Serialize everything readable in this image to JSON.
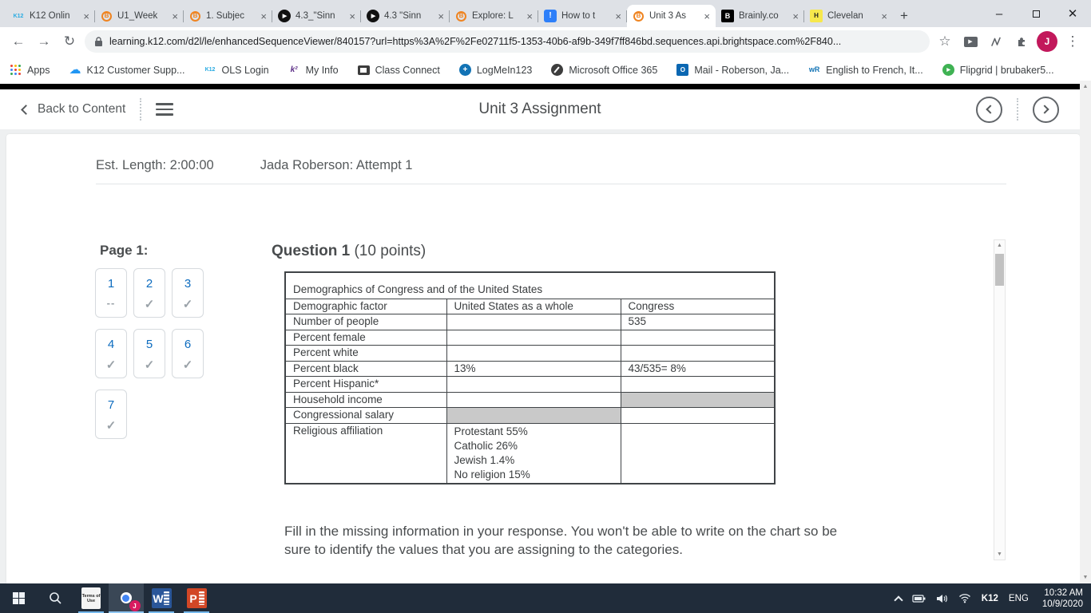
{
  "icons": {
    "close_tab": "×",
    "new_tab": "+",
    "minimize": "–",
    "close_window": "✕",
    "back": "←",
    "forward": "→",
    "reload": "↻",
    "star": "☆",
    "kebab": "⋮",
    "check": "✓",
    "dash": "--",
    "play": "▶",
    "scroll_up": "▲",
    "scroll_down": "▼"
  },
  "browser": {
    "tabs": [
      {
        "title": "K12 Onlin",
        "icon": "k12",
        "icon_text": "K12",
        "active": false
      },
      {
        "title": "U1_Week",
        "icon": "brainly-orange",
        "icon_text": "B",
        "active": false
      },
      {
        "title": "1. Subjec",
        "icon": "brainly-orange",
        "icon_text": "B",
        "active": false
      },
      {
        "title": "4.3_\"Sinn",
        "icon": "play",
        "icon_text": "▶",
        "active": false
      },
      {
        "title": "4.3 \"Sinn",
        "icon": "play",
        "icon_text": "▶",
        "active": false
      },
      {
        "title": "Explore: L",
        "icon": "brainly-orange",
        "icon_text": "B",
        "active": false
      },
      {
        "title": "How to t",
        "icon": "howto",
        "icon_text": "!",
        "active": false
      },
      {
        "title": "Unit 3 As",
        "icon": "brightspace",
        "icon_text": "B",
        "active": true
      },
      {
        "title": "Brainly.co",
        "icon": "brainly-black",
        "icon_text": "B",
        "active": false
      },
      {
        "title": "Clevelan",
        "icon": "cleveland",
        "icon_text": "H",
        "active": false
      }
    ],
    "address": {
      "url": "learning.k12.com/d2l/le/enhancedSequenceViewer/840157?url=https%3A%2F%2Fe02711f5-1353-40b6-af9b-349f7ff846bd.sequences.api.brightspace.com%2F840...",
      "profile_initial": "J"
    },
    "bookmarks": [
      {
        "label": "Apps",
        "icon": "apps",
        "icon_text": ""
      },
      {
        "label": "K12 Customer Supp...",
        "icon": "cloud",
        "icon_text": "☁"
      },
      {
        "label": "OLS Login",
        "icon": "k12",
        "icon_text": "K12"
      },
      {
        "label": "My Info",
        "icon": "myinfo",
        "icon_text": "k²"
      },
      {
        "label": "Class Connect",
        "icon": "cc",
        "icon_text": ""
      },
      {
        "label": "LogMeIn123",
        "icon": "lmi",
        "icon_text": "+"
      },
      {
        "label": "Microsoft Office 365",
        "icon": "office",
        "icon_text": ""
      },
      {
        "label": "Mail - Roberson, Ja...",
        "icon": "outlook",
        "icon_text": "O"
      },
      {
        "label": "English to French, It...",
        "icon": "wr",
        "icon_text": "wR"
      },
      {
        "label": "Flipgrid | brubaker5...",
        "icon": "flip",
        "icon_text": "▶"
      }
    ]
  },
  "lms": {
    "header": {
      "back_label": "Back to Content",
      "title": "Unit 3 Assignment"
    },
    "meta": {
      "est_length": "Est. Length: 2:00:00",
      "attempt": "Jada Roberson: Attempt 1"
    },
    "pager": {
      "label": "Page 1:",
      "items": [
        {
          "n": "1",
          "mark": "dash"
        },
        {
          "n": "2",
          "mark": "check"
        },
        {
          "n": "3",
          "mark": "check"
        },
        {
          "n": "4",
          "mark": "check"
        },
        {
          "n": "5",
          "mark": "check"
        },
        {
          "n": "6",
          "mark": "check"
        },
        {
          "n": "7",
          "mark": "check"
        }
      ]
    },
    "question": {
      "title": "Question 1",
      "points": "(10 points)",
      "table": {
        "caption": "Demographics of Congress and of the United States",
        "headers": [
          "Demographic factor",
          "United States as a whole",
          "Congress"
        ],
        "rows": [
          {
            "cells": [
              "Number of people",
              "",
              "535"
            ]
          },
          {
            "cells": [
              "Percent female",
              "",
              ""
            ]
          },
          {
            "cells": [
              "Percent white",
              "",
              ""
            ]
          },
          {
            "cells": [
              "Percent black",
              "13%",
              "43/535= 8%"
            ]
          },
          {
            "cells": [
              "Percent Hispanic*",
              "",
              ""
            ]
          },
          {
            "cells": [
              "Household income",
              "",
              ""
            ],
            "shaded": 2
          },
          {
            "cells": [
              "Congressional salary",
              "",
              ""
            ],
            "shaded": 1
          },
          {
            "cells": [
              "Religious affiliation",
              [
                "Protestant 55%",
                "Catholic 26%",
                "Jewish 1.4%",
                "No religion 15%"
              ],
              ""
            ]
          }
        ]
      },
      "instructions": "Fill in the missing information in your response. You won't be able to write on the chart so be sure to identify the values that you are assigning to the categories."
    }
  },
  "taskbar": {
    "terms_label": "Terms of Use",
    "chrome_badge": "J",
    "word_letter": "W",
    "ppt_letter": "P",
    "tray": {
      "brand": "K12",
      "lang": "ENG",
      "time": "10:32 AM",
      "date": "10/9/2020"
    }
  },
  "colors": {
    "accent_blue": "#0d6cbf",
    "shaded_cell": "#c9c9c9",
    "taskbar_bg": "#202c3a",
    "avatar": "#c2185b",
    "tabstrip_bg": "#dee1e6"
  }
}
